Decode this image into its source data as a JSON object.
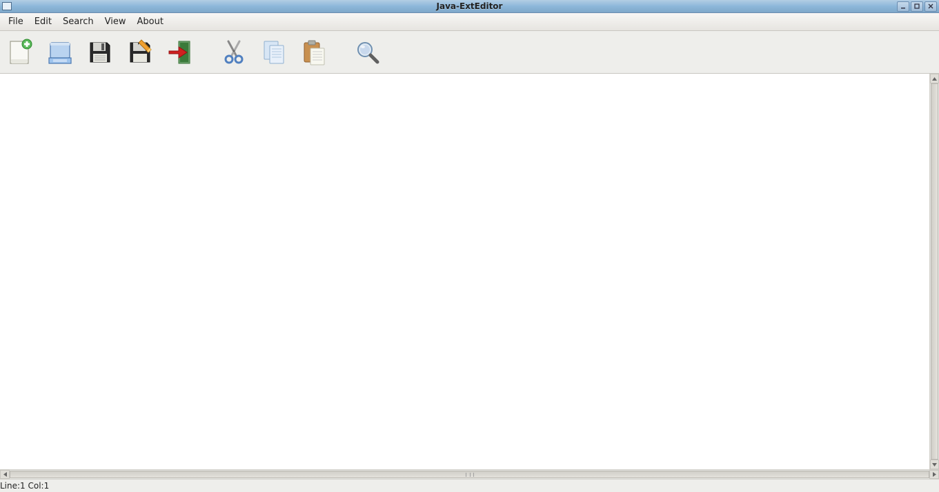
{
  "window": {
    "title": "Java-ExtEditor"
  },
  "menu": {
    "items": [
      "File",
      "Edit",
      "Search",
      "View",
      "About"
    ]
  },
  "toolbar": {
    "buttons": [
      {
        "name": "new-file-button",
        "icon": "new-file-icon"
      },
      {
        "name": "open-button",
        "icon": "open-icon"
      },
      {
        "name": "save-button",
        "icon": "save-icon"
      },
      {
        "name": "save-as-button",
        "icon": "save-as-icon"
      },
      {
        "name": "export-button",
        "icon": "export-icon"
      },
      {
        "name": "cut-button",
        "icon": "cut-icon"
      },
      {
        "name": "copy-button",
        "icon": "copy-icon"
      },
      {
        "name": "paste-button",
        "icon": "paste-icon"
      },
      {
        "name": "search-button",
        "icon": "search-icon"
      }
    ]
  },
  "editor": {
    "content": ""
  },
  "status": {
    "position": "Line:1 Col:1"
  }
}
